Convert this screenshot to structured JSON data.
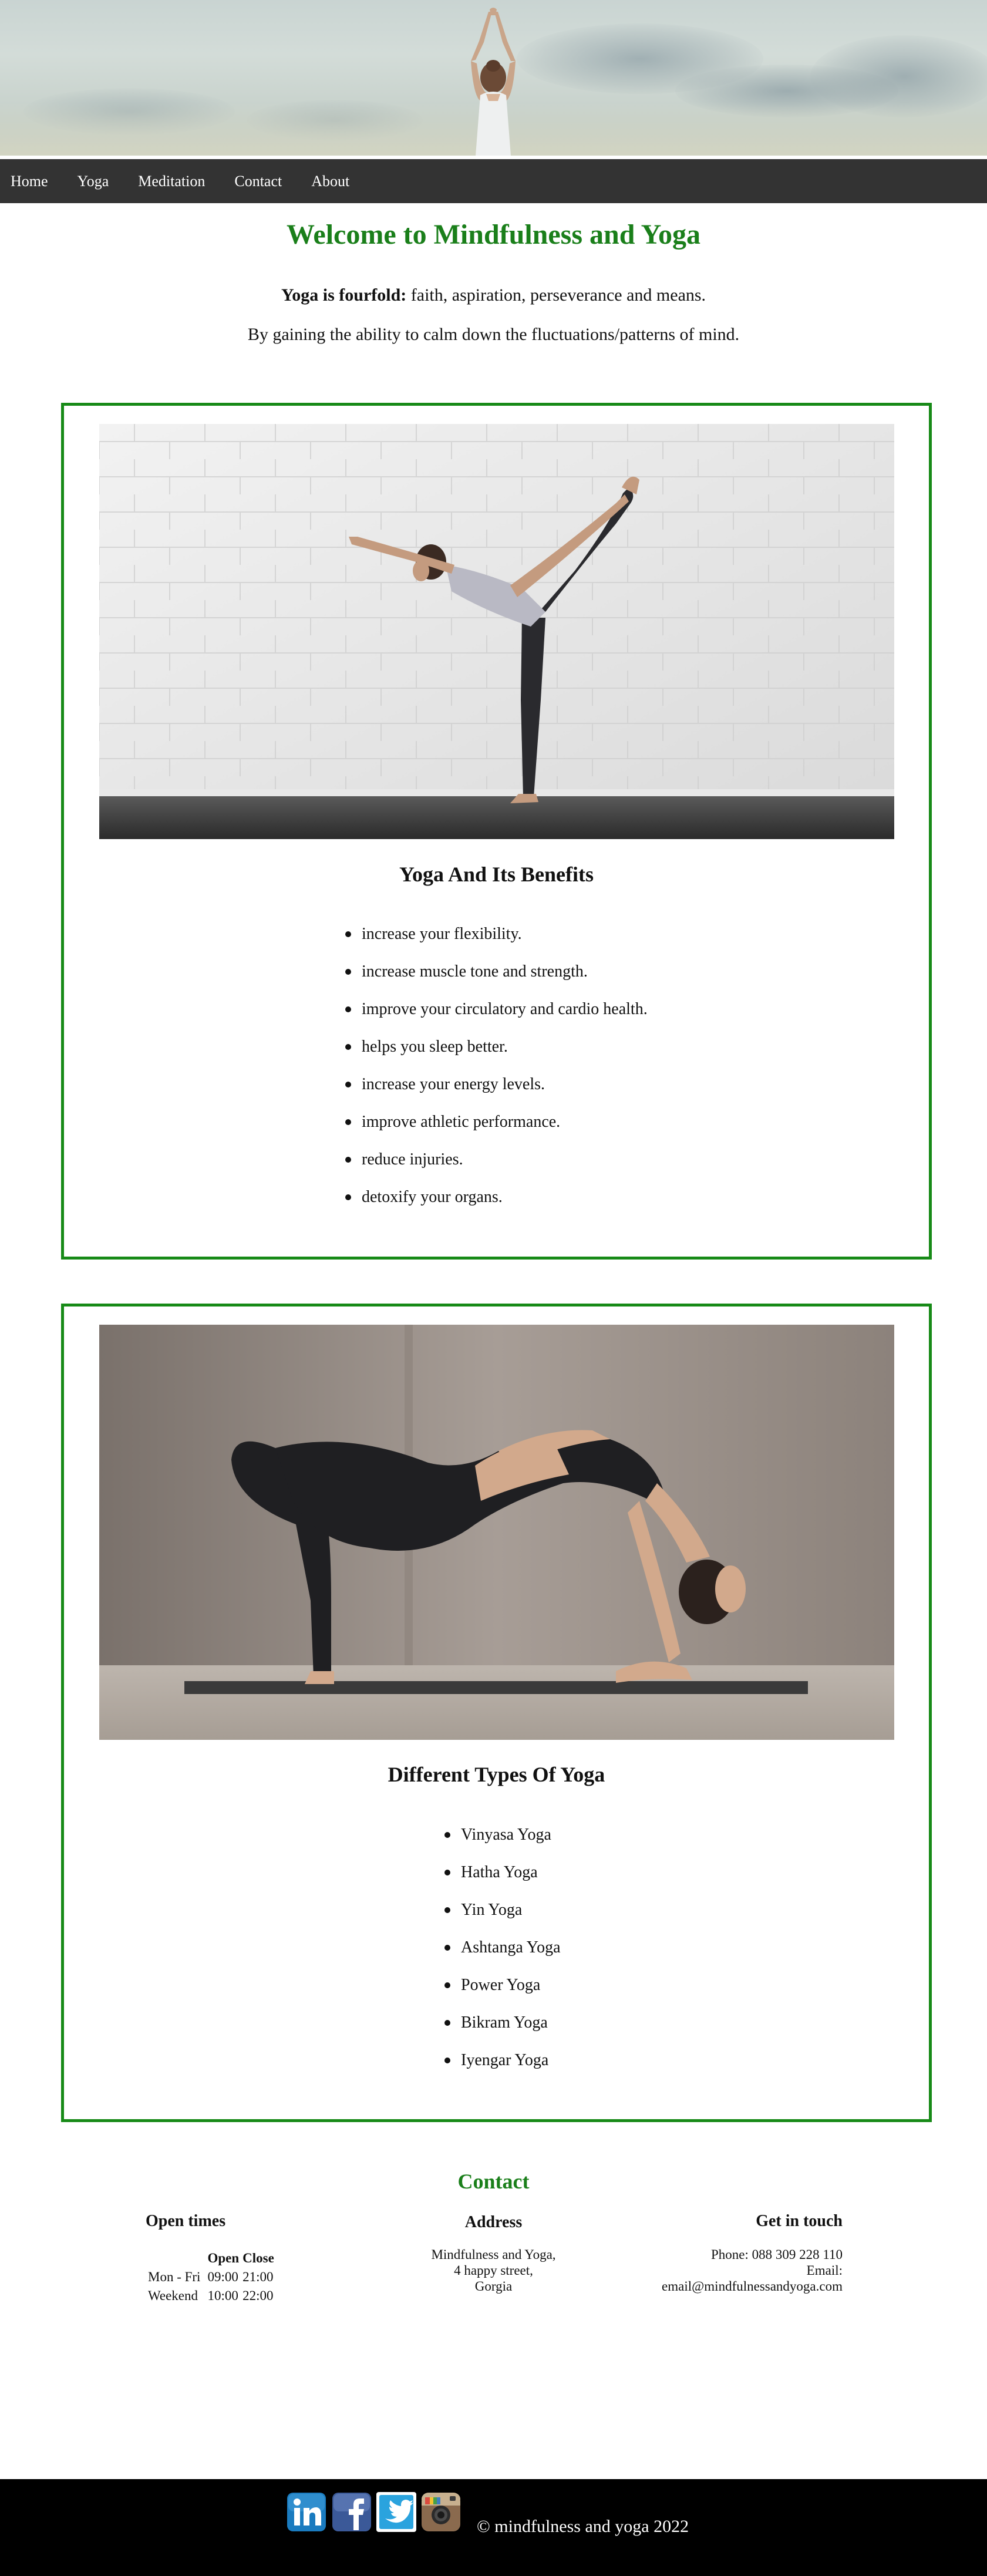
{
  "nav": {
    "items": [
      "Home",
      "Yoga",
      "Meditation",
      "Contact",
      "About"
    ]
  },
  "intro": {
    "title": "Welcome to Mindfulness and Yoga",
    "line1_strong": "Yoga is fourfold:",
    "line1_rest": " faith, aspiration, perseverance and means.",
    "line2": "By gaining the ability to calm down the fluctuations/patterns of mind."
  },
  "benefits": {
    "heading": "Yoga And Its Benefits",
    "items": [
      "increase your flexibility.",
      "increase muscle tone and strength.",
      "improve your circulatory and cardio health.",
      "helps you sleep better.",
      "increase your energy levels.",
      "improve athletic performance.",
      "reduce injuries.",
      "detoxify your organs."
    ]
  },
  "types": {
    "heading": "Different Types Of Yoga",
    "items": [
      "Vinyasa Yoga",
      "Hatha Yoga",
      "Yin Yoga",
      "Ashtanga Yoga",
      "Power Yoga",
      "Bikram Yoga",
      "Iyengar Yoga"
    ]
  },
  "contact": {
    "title": "Contact",
    "open_times": {
      "heading": "Open times",
      "col_open": "Open",
      "col_close": "Close",
      "rows": [
        {
          "day": "Mon - Fri",
          "open": "09:00",
          "close": "21:00"
        },
        {
          "day": "Weekend",
          "open": "10:00",
          "close": "22:00"
        }
      ]
    },
    "address": {
      "heading": "Address",
      "lines": [
        "Mindfulness and Yoga,",
        "4 happy street,",
        "Gorgia"
      ]
    },
    "get_in_touch": {
      "heading": "Get in touch",
      "phone": "Phone: 088 309 228 110",
      "email_label": "Email:",
      "email": "email@mindfulnessandyoga.com"
    }
  },
  "footer": {
    "social_icons": [
      "linkedin-icon",
      "facebook-icon",
      "twitter-icon",
      "instagram-icon"
    ],
    "copyright": "© mindfulness and yoga 2022"
  },
  "colors": {
    "accent_green": "#1a7f1a",
    "card_border": "#178a17",
    "nav_bg": "#333333",
    "footer_bg": "#000000"
  }
}
